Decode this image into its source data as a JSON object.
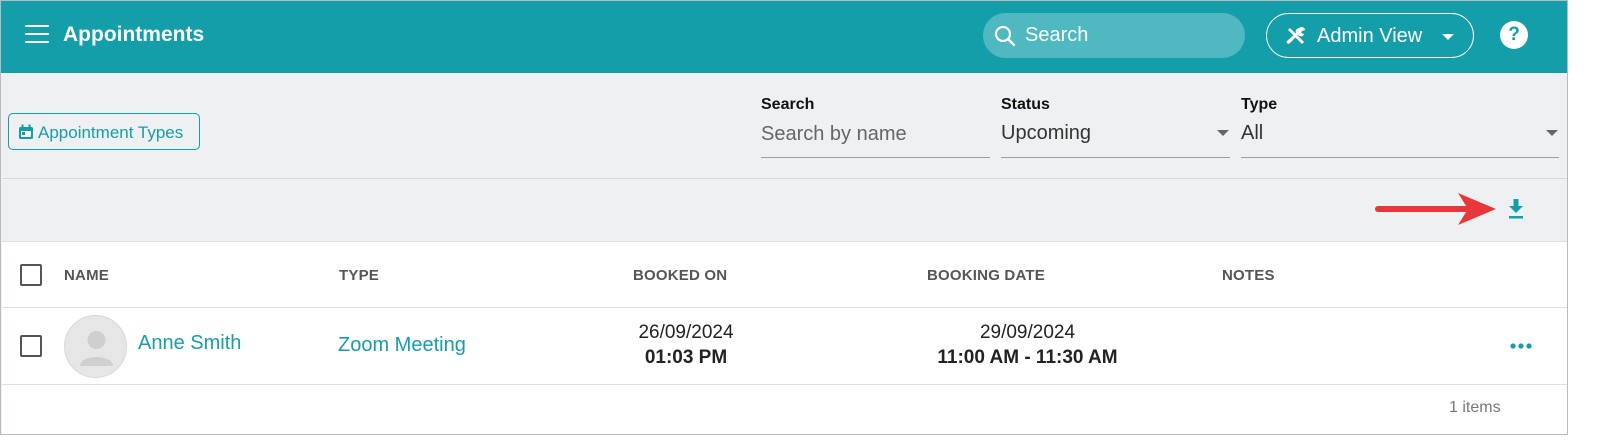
{
  "header": {
    "title": "Appointments",
    "search_placeholder": "Search",
    "admin_view_label": "Admin View",
    "help_label": "?"
  },
  "toolbar": {
    "appointment_types_label": "Appointment Types"
  },
  "filters": {
    "search": {
      "label": "Search",
      "placeholder": "Search by name"
    },
    "status": {
      "label": "Status",
      "value": "Upcoming"
    },
    "type": {
      "label": "Type",
      "value": "All"
    }
  },
  "table": {
    "columns": [
      "NAME",
      "TYPE",
      "BOOKED ON",
      "BOOKING DATE",
      "NOTES"
    ],
    "rows": [
      {
        "name": "Anne Smith",
        "type": "Zoom Meeting",
        "booked_on_date": "26/09/2024",
        "booked_on_time": "01:03 PM",
        "booking_date": "29/09/2024",
        "booking_time": "11:00 AM - 11:30 AM",
        "notes": ""
      }
    ],
    "items_count": "1 items"
  },
  "colors": {
    "primary": "#149eaa",
    "annotation_arrow": "#e8373a"
  },
  "icons": [
    "menu-icon",
    "search-icon",
    "tools-icon",
    "help-icon",
    "calendar-icon",
    "download-icon",
    "avatar-icon",
    "more-icon"
  ]
}
